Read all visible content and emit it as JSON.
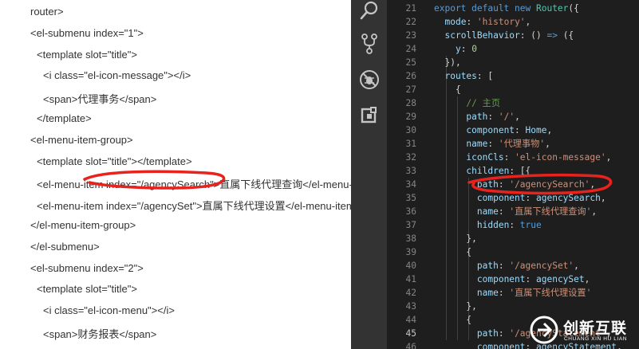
{
  "left_panel": {
    "lines": [
      {
        "indent": 0,
        "text": "router>"
      },
      {
        "indent": 0,
        "text": "<el-submenu index=\"1\">"
      },
      {
        "indent": 1,
        "text": "<template slot=\"title\">"
      },
      {
        "indent": 2,
        "text": "<i class=\"el-icon-message\"></i>"
      },
      {
        "indent": 2,
        "text": "<span>代理事务</span>"
      },
      {
        "indent": 1,
        "text": "</template>"
      },
      {
        "indent": 0,
        "text": "<el-menu-item-group>"
      },
      {
        "indent": 1,
        "text": "<template slot=\"title\"></template>"
      },
      {
        "indent": 1,
        "text": "<el-menu-item index=\"/agencySearch\">直属下线代理查询</el-menu-item>"
      },
      {
        "indent": 1,
        "text": "<el-menu-item index=\"/agencySet\">直属下线代理设置</el-menu-item>"
      },
      {
        "indent": 0,
        "text": "</el-menu-item-group>"
      },
      {
        "indent": 0,
        "text": "</el-submenu>"
      },
      {
        "indent": 0,
        "text": "<el-submenu index=\"2\">"
      },
      {
        "indent": 1,
        "text": "<template slot=\"title\">"
      },
      {
        "indent": 2,
        "text": "<i class=\"el-icon-menu\"></i>"
      },
      {
        "indent": 2,
        "text": "<span>财务报表</span>"
      },
      {
        "indent": 1,
        "text": "</template>"
      }
    ]
  },
  "activity_bar": {
    "icons": [
      "search-icon",
      "source-control-icon",
      "debug-icon",
      "extensions-icon"
    ]
  },
  "editor": {
    "current_line": 45,
    "lines": [
      {
        "num": 21,
        "tokens": [
          [
            "kw",
            "export default new "
          ],
          [
            "fn",
            "Router"
          ],
          [
            "tx",
            "({"
          ]
        ]
      },
      {
        "num": 22,
        "tokens": [
          [
            "tx",
            "  "
          ],
          [
            "pr",
            "mode"
          ],
          [
            "tx",
            ": "
          ],
          [
            "st",
            "'history'"
          ],
          [
            "tx",
            ","
          ]
        ]
      },
      {
        "num": 23,
        "tokens": [
          [
            "tx",
            "  "
          ],
          [
            "pr",
            "scrollBehavior"
          ],
          [
            "tx",
            ": () "
          ],
          [
            "kw",
            "=>"
          ],
          [
            "tx",
            " ({"
          ]
        ]
      },
      {
        "num": 24,
        "tokens": [
          [
            "tx",
            "    "
          ],
          [
            "pr",
            "y"
          ],
          [
            "tx",
            ": "
          ],
          [
            "nm",
            "0"
          ]
        ]
      },
      {
        "num": 25,
        "tokens": [
          [
            "tx",
            "  }),"
          ]
        ]
      },
      {
        "num": 26,
        "tokens": [
          [
            "tx",
            "  "
          ],
          [
            "pr",
            "routes"
          ],
          [
            "tx",
            ": ["
          ]
        ]
      },
      {
        "num": 27,
        "tokens": [
          [
            "tx",
            "    {"
          ]
        ]
      },
      {
        "num": 28,
        "tokens": [
          [
            "tx",
            "      "
          ],
          [
            "cm",
            "// 主页"
          ]
        ]
      },
      {
        "num": 29,
        "tokens": [
          [
            "tx",
            "      "
          ],
          [
            "pr",
            "path"
          ],
          [
            "tx",
            ": "
          ],
          [
            "st",
            "'/'"
          ],
          [
            "tx",
            ","
          ]
        ]
      },
      {
        "num": 30,
        "tokens": [
          [
            "tx",
            "      "
          ],
          [
            "pr",
            "component"
          ],
          [
            "tx",
            ": "
          ],
          [
            "pr",
            "Home"
          ],
          [
            "tx",
            ","
          ]
        ]
      },
      {
        "num": 31,
        "tokens": [
          [
            "tx",
            "      "
          ],
          [
            "pr",
            "name"
          ],
          [
            "tx",
            ": "
          ],
          [
            "st",
            "'代理事物'"
          ],
          [
            "tx",
            ","
          ]
        ]
      },
      {
        "num": 32,
        "tokens": [
          [
            "tx",
            "      "
          ],
          [
            "pr",
            "iconCls"
          ],
          [
            "tx",
            ": "
          ],
          [
            "st",
            "'el-icon-message'"
          ],
          [
            "tx",
            ","
          ]
        ]
      },
      {
        "num": 33,
        "tokens": [
          [
            "tx",
            "      "
          ],
          [
            "pr",
            "children"
          ],
          [
            "tx",
            ": [{"
          ]
        ]
      },
      {
        "num": 34,
        "tokens": [
          [
            "tx",
            "        "
          ],
          [
            "pr",
            "path"
          ],
          [
            "tx",
            ": "
          ],
          [
            "st",
            "'/agencySearch'"
          ],
          [
            "tx",
            ","
          ]
        ]
      },
      {
        "num": 35,
        "tokens": [
          [
            "tx",
            "        "
          ],
          [
            "pr",
            "component"
          ],
          [
            "tx",
            ": "
          ],
          [
            "pr",
            "agencySearch"
          ],
          [
            "tx",
            ","
          ]
        ]
      },
      {
        "num": 36,
        "tokens": [
          [
            "tx",
            "        "
          ],
          [
            "pr",
            "name"
          ],
          [
            "tx",
            ": "
          ],
          [
            "st",
            "'直属下线代理查询'"
          ],
          [
            "tx",
            ","
          ]
        ]
      },
      {
        "num": 37,
        "tokens": [
          [
            "tx",
            "        "
          ],
          [
            "pr",
            "hidden"
          ],
          [
            "tx",
            ": "
          ],
          [
            "kw",
            "true"
          ]
        ]
      },
      {
        "num": 38,
        "tokens": [
          [
            "tx",
            "      },"
          ]
        ]
      },
      {
        "num": 39,
        "tokens": [
          [
            "tx",
            "      {"
          ]
        ]
      },
      {
        "num": 40,
        "tokens": [
          [
            "tx",
            "        "
          ],
          [
            "pr",
            "path"
          ],
          [
            "tx",
            ": "
          ],
          [
            "st",
            "'/agencySet'"
          ],
          [
            "tx",
            ","
          ]
        ]
      },
      {
        "num": 41,
        "tokens": [
          [
            "tx",
            "        "
          ],
          [
            "pr",
            "component"
          ],
          [
            "tx",
            ": "
          ],
          [
            "pr",
            "agencySet"
          ],
          [
            "tx",
            ","
          ]
        ]
      },
      {
        "num": 42,
        "tokens": [
          [
            "tx",
            "        "
          ],
          [
            "pr",
            "name"
          ],
          [
            "tx",
            ": "
          ],
          [
            "st",
            "'直属下线代理设置'"
          ]
        ]
      },
      {
        "num": 43,
        "tokens": [
          [
            "tx",
            "      },"
          ]
        ]
      },
      {
        "num": 44,
        "tokens": [
          [
            "tx",
            "      {"
          ]
        ]
      },
      {
        "num": 45,
        "tokens": [
          [
            "tx",
            "        "
          ],
          [
            "pr",
            "path"
          ],
          [
            "tx",
            ": "
          ],
          [
            "st",
            "'/agencyStatement'"
          ],
          [
            "tx",
            ","
          ]
        ]
      },
      {
        "num": 46,
        "tokens": [
          [
            "tx",
            "        "
          ],
          [
            "pr",
            "component"
          ],
          [
            "tx",
            ": "
          ],
          [
            "pr",
            "agencyStatement"
          ],
          [
            "tx",
            ","
          ]
        ]
      }
    ]
  },
  "watermark": {
    "name": "创新互联",
    "subtitle": "CHUANG XIN HU LIAN"
  }
}
